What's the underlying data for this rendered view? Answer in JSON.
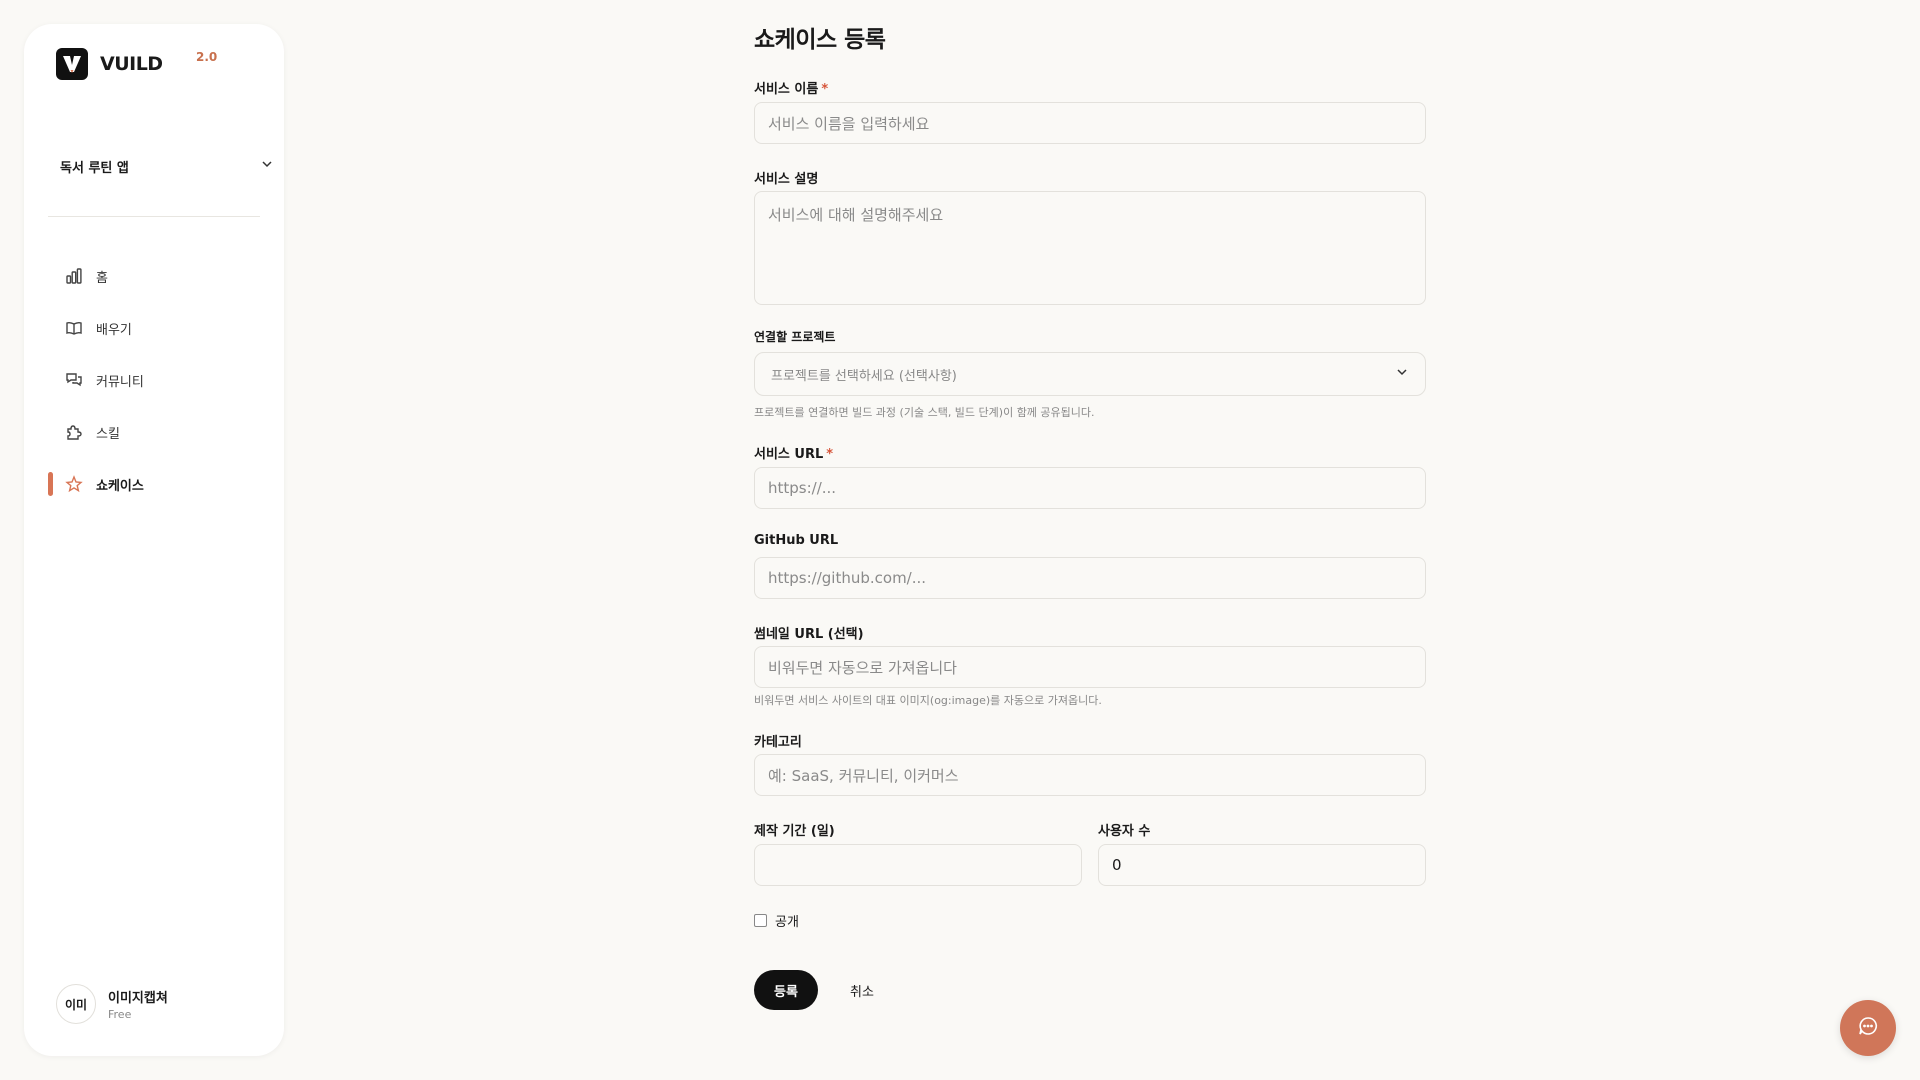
{
  "brand": {
    "name": "VUILD",
    "version": "2.0"
  },
  "sidebar": {
    "project": "독서 루틴 앱",
    "items": [
      {
        "label": "홈",
        "icon": "bar-chart-icon"
      },
      {
        "label": "배우기",
        "icon": "book-icon"
      },
      {
        "label": "커뮤니티",
        "icon": "chat-bubbles-icon"
      },
      {
        "label": "스킬",
        "icon": "puzzle-icon"
      },
      {
        "label": "쇼케이스",
        "icon": "star-icon",
        "active": true
      }
    ],
    "user": {
      "avatar": "이미",
      "name": "이미지캡쳐",
      "plan": "Free"
    }
  },
  "form": {
    "title": "쇼케이스 등록",
    "service_name": {
      "label": "서비스 이름",
      "required_mark": "*",
      "placeholder": "서비스 이름을 입력하세요"
    },
    "service_desc": {
      "label": "서비스 설명",
      "placeholder": "서비스에 대해 설명해주세요"
    },
    "project": {
      "label": "연결할 프로젝트",
      "placeholder": "프로젝트를 선택하세요 (선택사항)",
      "helper": "프로젝트를 연결하면 빌드 과정 (기술 스택, 빌드 단계)이 함께 공유됩니다."
    },
    "service_url": {
      "label": "서비스 URL",
      "required_mark": "*",
      "placeholder": "https://..."
    },
    "github_url": {
      "label": "GitHub URL",
      "placeholder": "https://github.com/..."
    },
    "thumbnail_url": {
      "label": "썸네일 URL (선택)",
      "placeholder": "비워두면 자동으로 가져옵니다",
      "helper": "비워두면 서비스 사이트의 대표 이미지(og:image)를 자동으로 가져옵니다."
    },
    "category": {
      "label": "카테고리",
      "placeholder": "예: SaaS, 커뮤니티, 이커머스"
    },
    "duration": {
      "label": "제작 기간 (일)",
      "value": ""
    },
    "users": {
      "label": "사용자 수",
      "value": "0"
    },
    "public": {
      "label": "공개",
      "checked": false
    },
    "submit_label": "등록",
    "cancel_label": "취소"
  },
  "colors": {
    "accent": "#d07659",
    "primary": "#111111",
    "background": "#faf9f6",
    "required": "#d6553a"
  }
}
